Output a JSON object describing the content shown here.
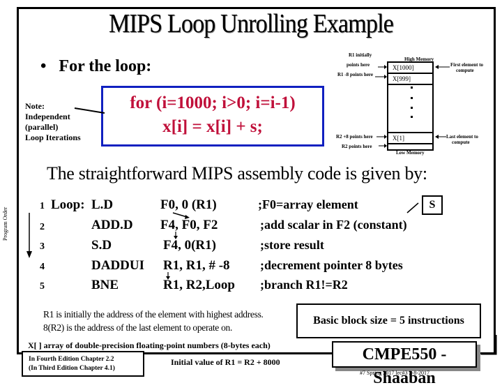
{
  "slide": {
    "title": "MIPS Loop Unrolling Example",
    "bullet": "For the loop:",
    "bullet_marker": "•",
    "loop_code": [
      "for (i=1000; i>0; i=i-1)",
      "x[i] = x[i] + s;"
    ],
    "note": [
      "Note:",
      "Independent",
      "(parallel)",
      "Loop Iterations"
    ],
    "memory": {
      "r1_initially": "R1 initially",
      "points_here": "points here",
      "r1_minus8": "R1 -8 points here",
      "high_memory": "High Memory",
      "cells_top": [
        "X[1000]",
        "X[999]"
      ],
      "cell_bottom": "X[1]",
      "first_element": [
        "First element to",
        "compute"
      ],
      "r2_plus8": "R2 +8 points here",
      "r2_points": "R2 points here",
      "last_element": [
        "Last element to",
        "compute"
      ],
      "low_memory": "Low Memory"
    },
    "heading2": "The straightforward MIPS assembly code is given by:",
    "program_order_label": "Program Order",
    "code_lines": [
      {
        "num": "1",
        "label": "Loop:",
        "op": "L.D",
        "args": "F0, 0 (R1)",
        "comment": ";F0=array element"
      },
      {
        "num": "2",
        "label": "",
        "op": "ADD.D",
        "args": "F4, F0, F2",
        "comment": ";add scalar in F2  (constant)"
      },
      {
        "num": "3",
        "label": "",
        "op": "S.D",
        "args": "F4, 0(R1)",
        "comment": ";store result"
      },
      {
        "num": "4",
        "label": "",
        "op": "DADDUI",
        "args": "R1, R1, # -8",
        "comment": ";decrement pointer 8 bytes"
      },
      {
        "num": "5",
        "label": "",
        "op": "BNE",
        "args": "R1, R2,Loop",
        "comment": ";branch R1!=R2"
      }
    ],
    "s_box": "S",
    "info_lines": [
      "R1 is  initially  the address of the element with highest address.",
      "8(R2)   is the address of the last element to operate on."
    ],
    "basic_block": "Basic block size  = 5  instructions",
    "x_array": "X[ ]   array of double-precision floating-point numbers (8-bytes each)",
    "edition": [
      "In Fourth Edition Chapter 2.2",
      "(In Third Edition Chapter 4.1)"
    ],
    "initial_value": "Initial value of R1 =  R2 + 8000",
    "course_badge": "CMPE550 - Shaaban",
    "footer": "#7  Spring 2017   lec#3  2-8-2017",
    "colors": {
      "loop_text": "#c0103a",
      "loop_border": "#1020c0"
    }
  }
}
